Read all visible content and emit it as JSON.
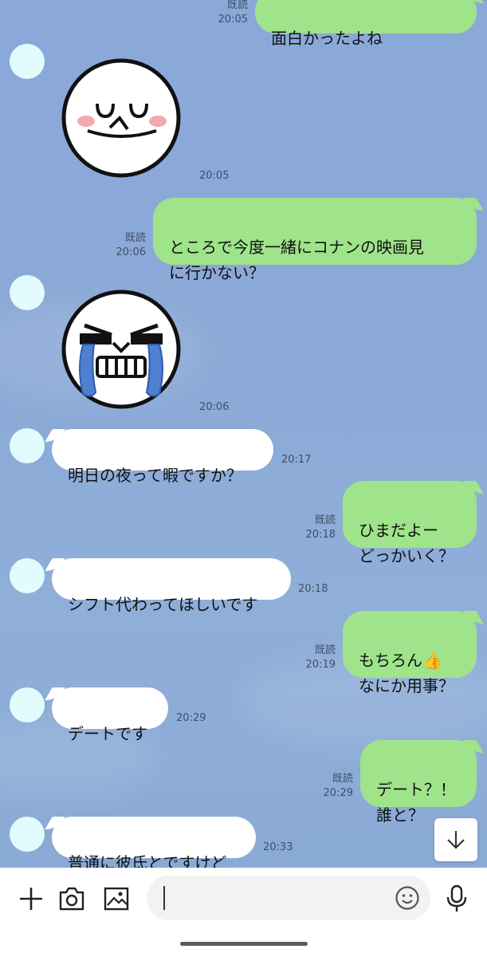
{
  "read_label": "既読",
  "messages": [
    {
      "id": "m0",
      "dir": "out",
      "text": "面白かったよね",
      "time": "20:05"
    },
    {
      "id": "m1",
      "dir": "in_sticker",
      "sticker": "smiling-moon-sticker",
      "time": "20:05"
    },
    {
      "id": "m2",
      "dir": "out",
      "text": "ところで今度一緒にコナンの映画見\nに行かない？",
      "time": "20:06"
    },
    {
      "id": "m3",
      "dir": "in_sticker",
      "sticker": "crying-moon-sticker",
      "time": "20:06"
    },
    {
      "id": "m4",
      "dir": "in",
      "text": "明日の夜って暇ですか？",
      "time": "20:17"
    },
    {
      "id": "m5",
      "dir": "out",
      "text": "ひまだよー\nどっかいく？",
      "time": "20:18"
    },
    {
      "id": "m6",
      "dir": "in",
      "text": "シフト代わってほしいです",
      "time": "20:18"
    },
    {
      "id": "m7",
      "dir": "out",
      "text": "もちろん👍\nなにか用事？",
      "time": "20:19"
    },
    {
      "id": "m8",
      "dir": "in",
      "text": "デートです",
      "time": "20:29"
    },
    {
      "id": "m9",
      "dir": "out",
      "text": "デート？！\n誰と？",
      "time": "20:29"
    },
    {
      "id": "m10",
      "dir": "in",
      "text": "普通に彼氏とですけど",
      "time": "20:33"
    }
  ],
  "colors": {
    "chat_bg": "#8eacd8",
    "incoming": "#ffffff",
    "outgoing": "#9fe38b",
    "avatar": "#e2fbfd"
  },
  "icons": {
    "add": "plus-icon",
    "camera": "camera-icon",
    "image": "image-icon",
    "emoji": "emoji-icon",
    "mic": "microphone-icon",
    "scroll": "arrow-down-icon"
  },
  "input": {
    "value": ""
  }
}
